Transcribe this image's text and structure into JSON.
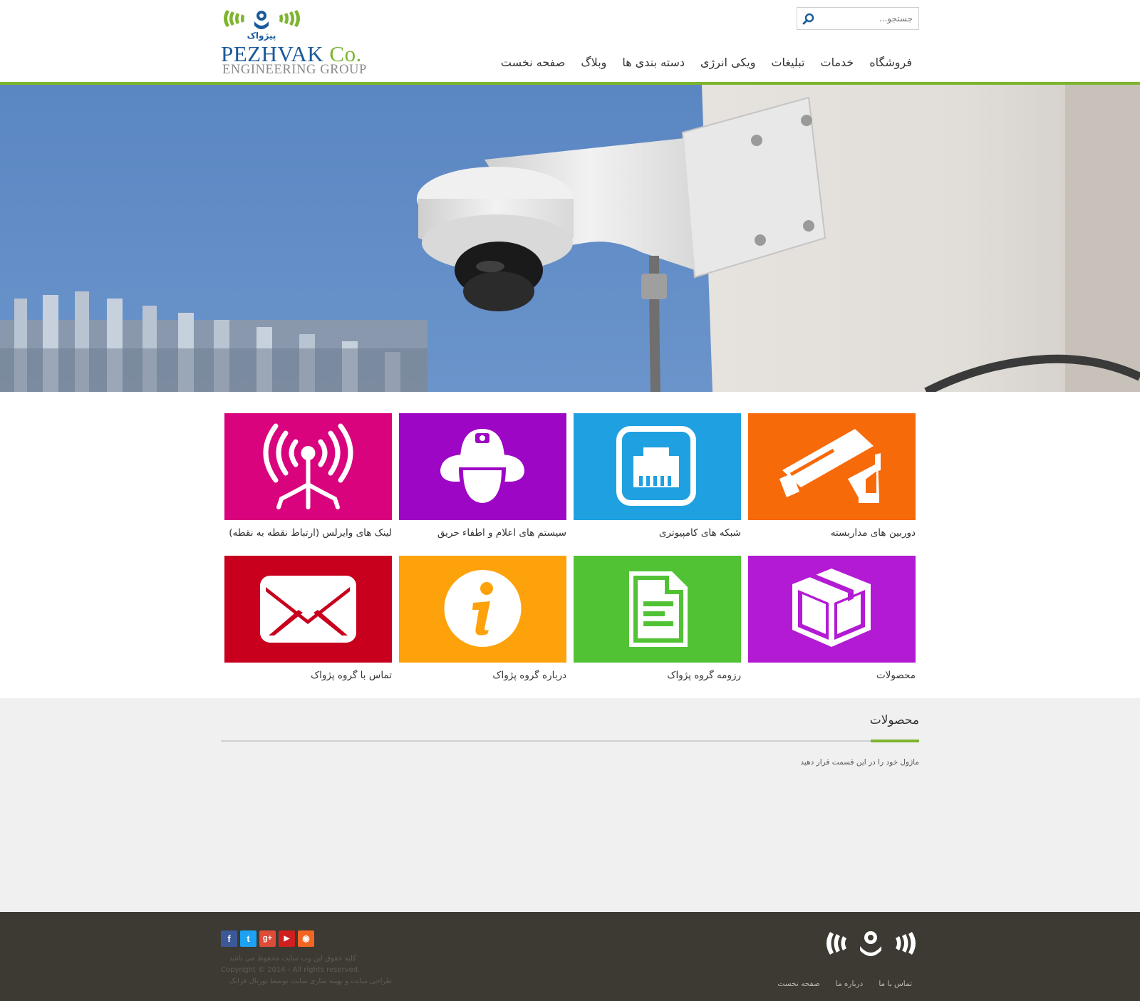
{
  "header": {
    "logo": {
      "brand": "PEZHVAK",
      "brand_suffix": "Co.",
      "tagline": "ENGINEERING GROUP",
      "wordmark": "پیژواک"
    },
    "search": {
      "placeholder": "جستجو..."
    },
    "nav": [
      {
        "label": "صفحه نخست"
      },
      {
        "label": "وبلاگ"
      },
      {
        "label": "دسته بندی ها"
      },
      {
        "label": "ویکی انرژی"
      },
      {
        "label": "تبلیغات"
      },
      {
        "label": "خدمات"
      },
      {
        "label": "فروشگاه"
      }
    ]
  },
  "tiles": [
    {
      "label": "دوربین های مداربسته",
      "color": "#f76a0a",
      "icon": "cctv-camera-icon"
    },
    {
      "label": "شبکه های کامپیوتری",
      "color": "#1fa0e0",
      "icon": "network-port-icon"
    },
    {
      "label": "سیستم های اعلام و اطفاء حریق",
      "color": "#9d06c5",
      "icon": "firefighter-helmet-icon"
    },
    {
      "label": "لینک های وایرلس (ارتباط نقطه به نقطه)",
      "color": "#d9037d",
      "icon": "wireless-antenna-icon"
    },
    {
      "label": "محصولات",
      "color": "#b31ad3",
      "icon": "box-icon"
    },
    {
      "label": "رزومه گروه پژواک",
      "color": "#52c235",
      "icon": "document-icon"
    },
    {
      "label": "درباره گروه پژواک",
      "color": "#fea20c",
      "icon": "info-icon"
    },
    {
      "label": "تماس با گروه پژواک",
      "color": "#c8001e",
      "icon": "mail-icon"
    }
  ],
  "products": {
    "title": "محصولات",
    "body": "ماژول خود را در این قسمت قرار دهید"
  },
  "footer": {
    "social": [
      {
        "name": "facebook-icon",
        "glyph": "f",
        "color": "#3b5998"
      },
      {
        "name": "twitter-icon",
        "glyph": "t",
        "color": "#1da1f2"
      },
      {
        "name": "google-plus-icon",
        "glyph": "g+",
        "color": "#dd4b39"
      },
      {
        "name": "youtube-icon",
        "glyph": "▶",
        "color": "#cd201f"
      },
      {
        "name": "rss-icon",
        "glyph": "◉",
        "color": "#f26522"
      }
    ],
    "rights_fa": "کلیه حقوق این وب سایت محفوظ می باشد",
    "copyright": "Copyright © 2014 - All rights reserved.",
    "credit": "طراحی سایت و بهینه سازی سایت توسط پورتال فراتک",
    "links": [
      {
        "label": "صفحه نخست"
      },
      {
        "label": "درباره ما"
      },
      {
        "label": "تماس با ما"
      }
    ]
  },
  "accent_color": "#7cb52d"
}
